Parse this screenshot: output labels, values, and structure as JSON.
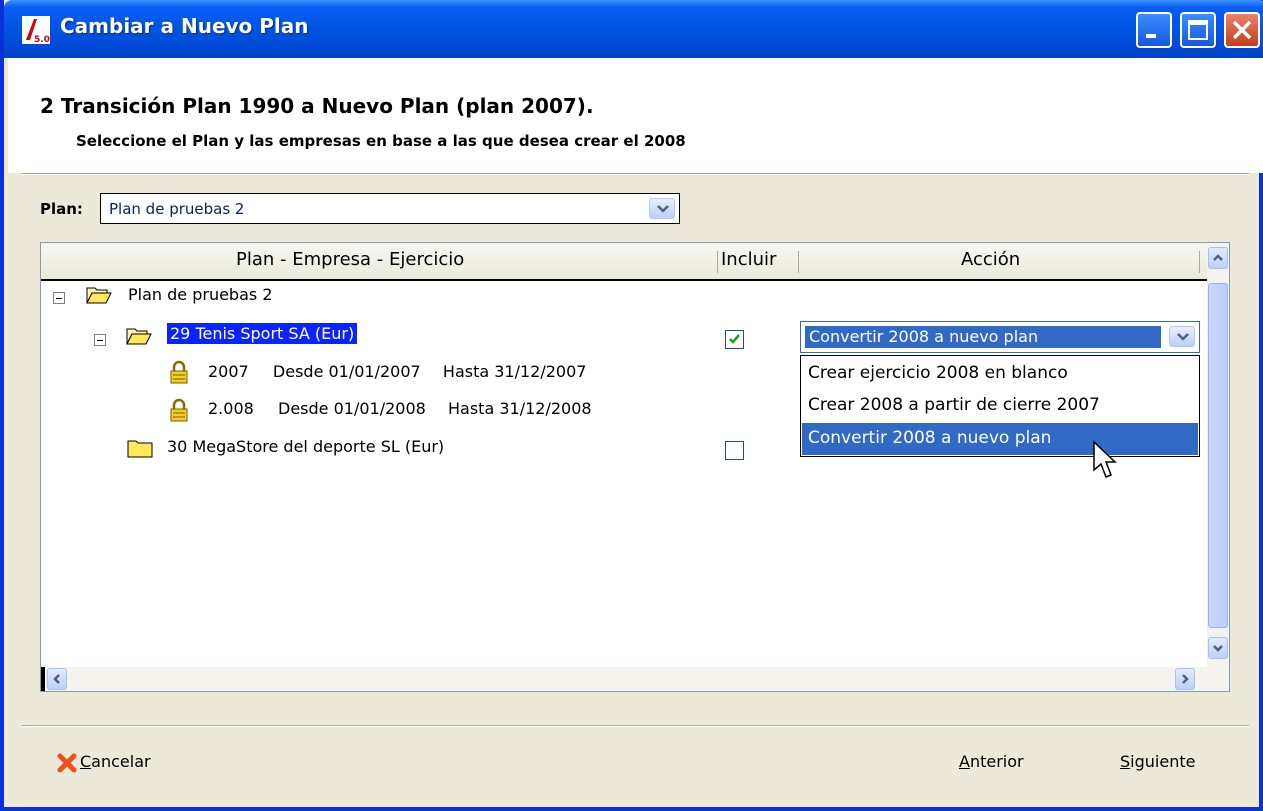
{
  "window": {
    "title": "Cambiar a Nuevo Plan",
    "app_icon_text": "5.0"
  },
  "header": {
    "title": "2 Transición Plan 1990 a Nuevo Plan (plan 2007).",
    "subtitle": "Seleccione el Plan y las empresas en base a las que desea crear el 2008"
  },
  "plan_selector": {
    "label": "Plan:",
    "value": "Plan de pruebas 2"
  },
  "grid": {
    "columns": [
      "Plan - Empresa - Ejercicio",
      "Incluir",
      "Acción"
    ],
    "tree": {
      "root": "Plan de pruebas 2",
      "company1": {
        "label": "29 Tenis Sport SA (Eur)",
        "included": true,
        "action": "Convertir 2008 a nuevo plan",
        "years": [
          {
            "year": "2007",
            "from": "Desde 01/01/2007",
            "to": "Hasta 31/12/2007"
          },
          {
            "year": "2.008",
            "from": "Desde 01/01/2008",
            "to": "Hasta 31/12/2008"
          }
        ]
      },
      "company2": {
        "label": "30 MegaStore del deporte SL (Eur)",
        "included": false
      }
    },
    "action_options": [
      "Crear ejercicio 2008 en blanco",
      "Crear 2008 a partir de cierre 2007",
      "Convertir 2008 a nuevo plan"
    ],
    "selected_option_index": 2
  },
  "footer": {
    "cancel_accel": "C",
    "cancel_rest": "ancelar",
    "prev_accel": "A",
    "prev_rest": "nterior",
    "next_accel": "S",
    "next_rest": "iguiente"
  },
  "colors": {
    "titlebar": "#0054e3",
    "selection": "#316ac5",
    "highlight": "#0a24ff",
    "dialog_bg": "#ece9d8"
  },
  "icons": [
    "app-icon",
    "minimize-icon",
    "maximize-icon",
    "close-icon",
    "folder-open-icon",
    "folder-closed-icon",
    "lock-icon",
    "checkmark-icon",
    "chevron-down-icon",
    "chevron-up-icon",
    "chevron-left-icon",
    "chevron-right-icon",
    "cancel-x-icon",
    "mouse-cursor-icon"
  ]
}
